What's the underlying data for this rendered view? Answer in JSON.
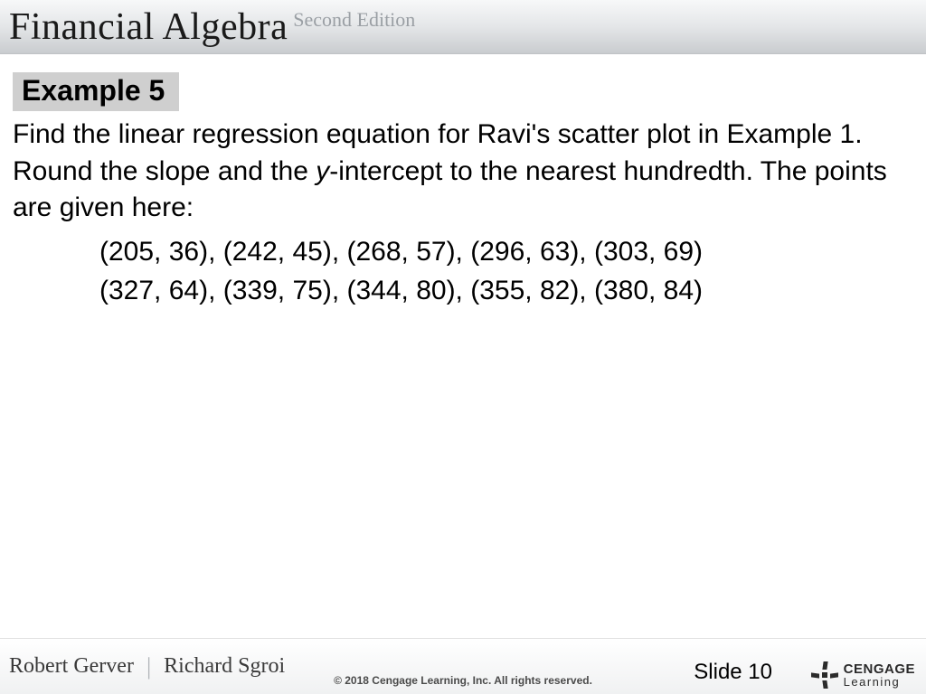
{
  "header": {
    "book_title": "Financial Algebra",
    "edition": "Second Edition"
  },
  "example": {
    "label": "Example 5",
    "problem_pre": "Find the linear regression equation for Ravi's scatter plot in Example 1. Round the slope and the ",
    "problem_italic": "y",
    "problem_post": "-intercept to the nearest hundredth. The points are given here:",
    "points_line1": "(205, 36), (242, 45), (268, 57), (296, 63), (303, 69)",
    "points_line2": "(327, 64), (339, 75), (344, 80), (355, 82), (380, 84)"
  },
  "footer": {
    "author1": "Robert Gerver",
    "author2": "Richard Sgroi",
    "copyright": "© 2018 Cengage Learning, Inc. All rights reserved.",
    "slide": "Slide 10",
    "publisher_line1": "CENGAGE",
    "publisher_line2": "Learning"
  }
}
